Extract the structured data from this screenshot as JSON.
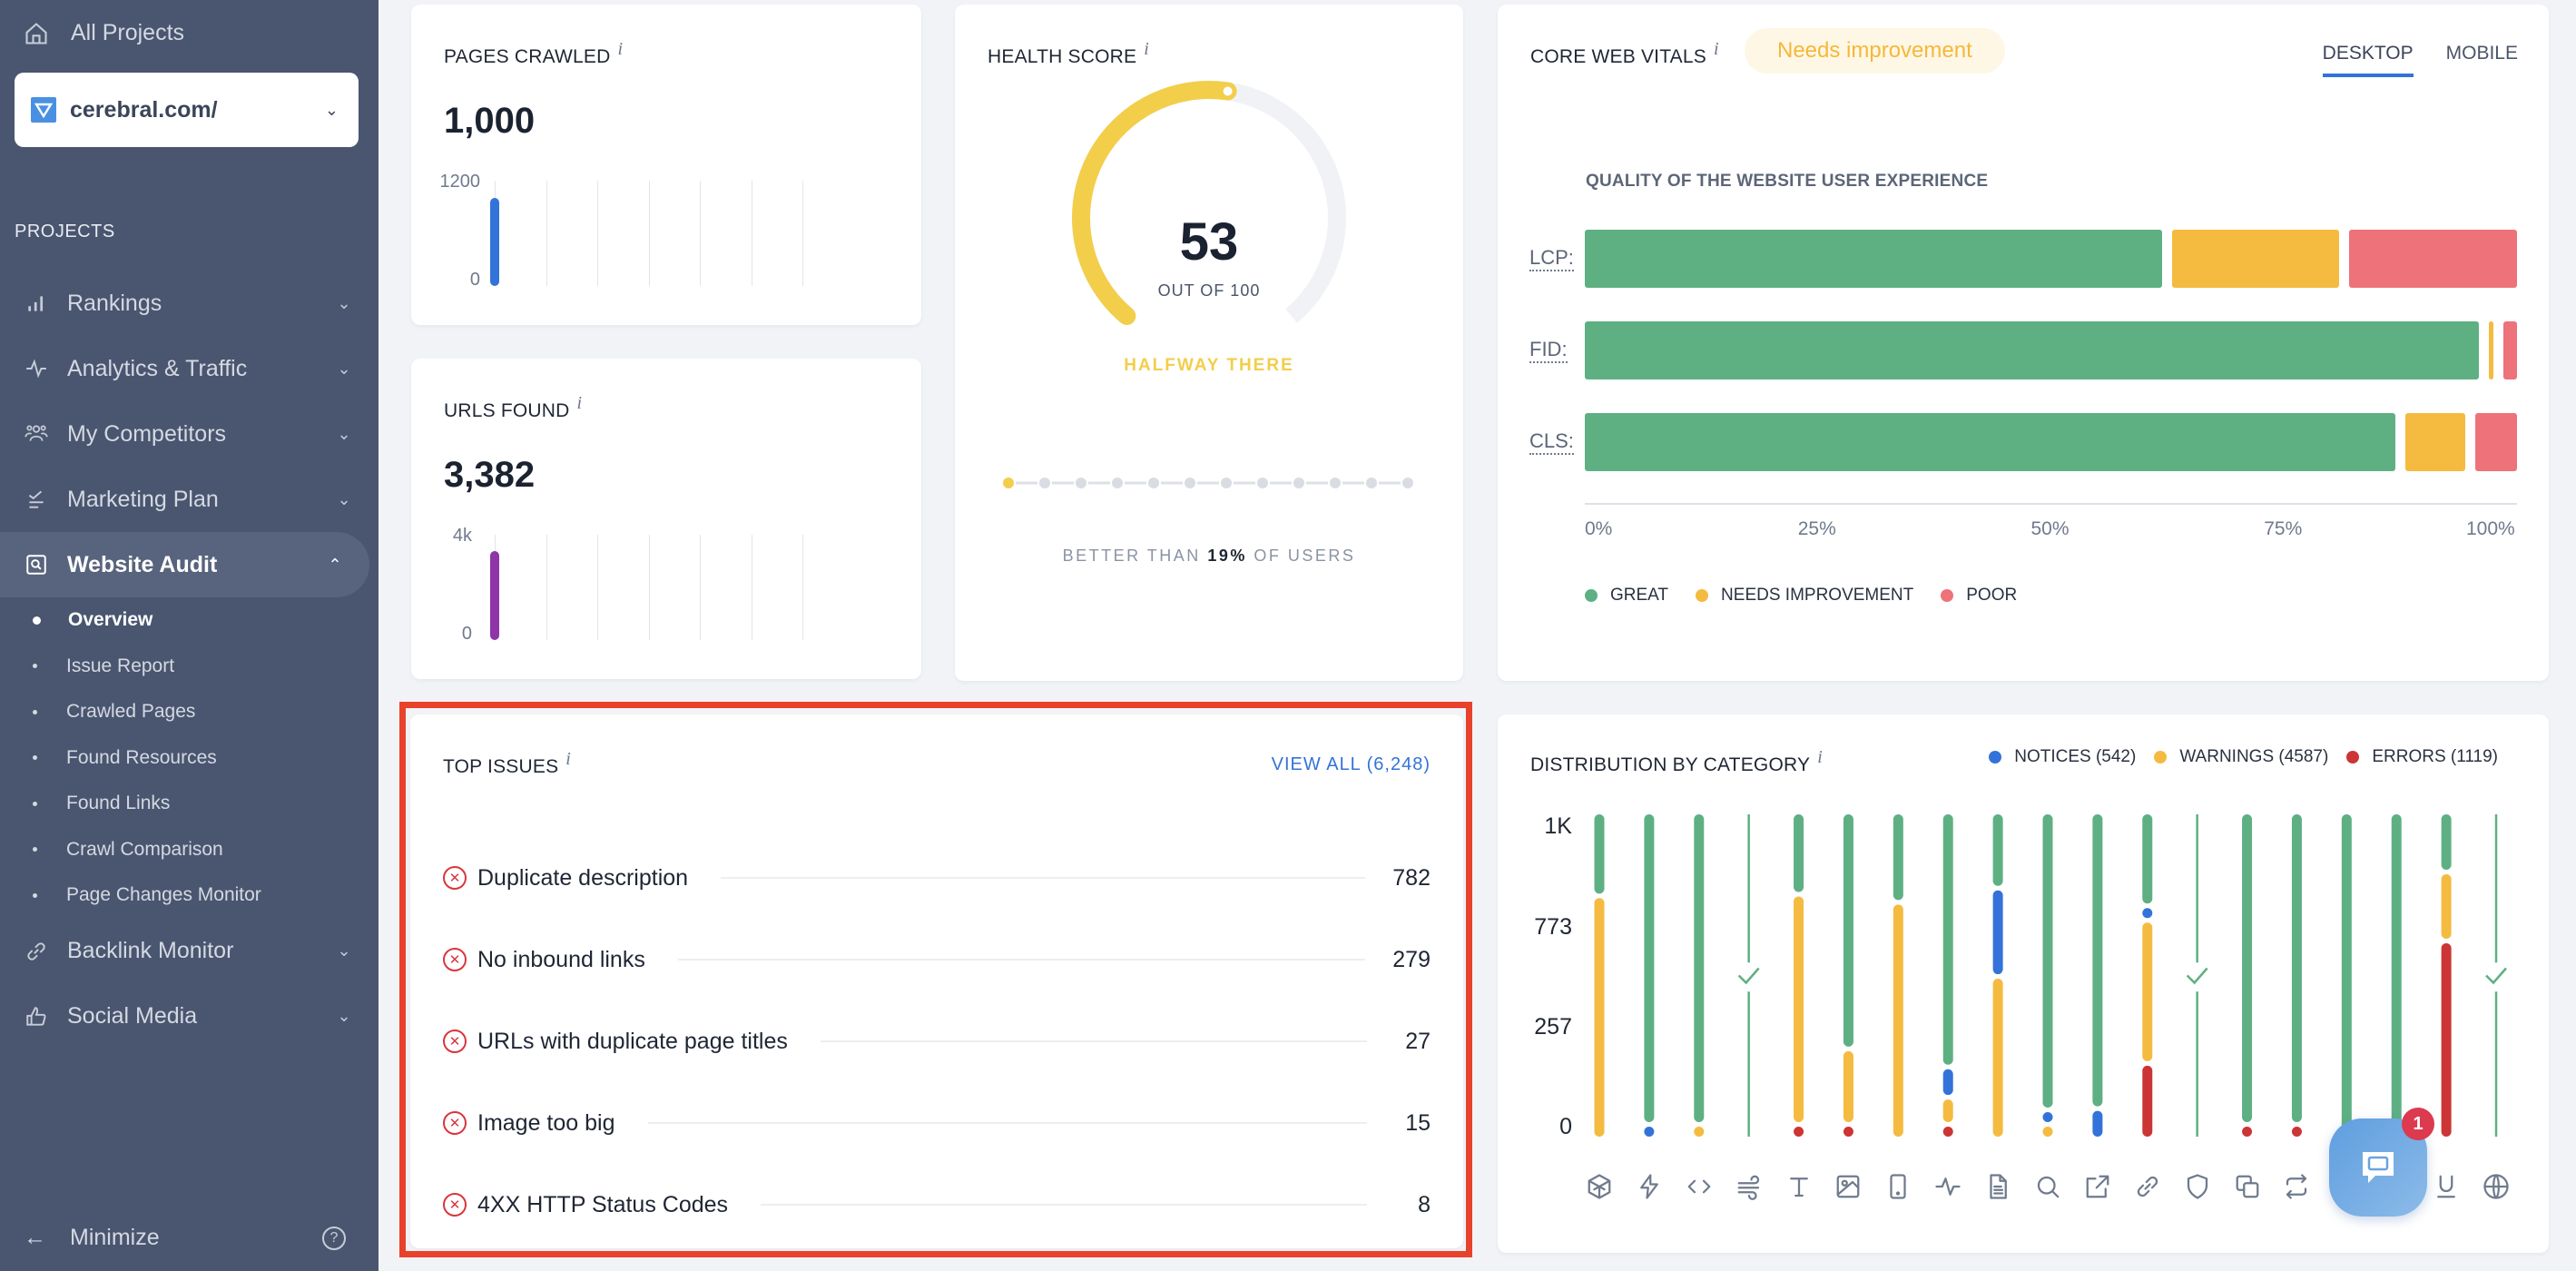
{
  "sidebar": {
    "all_projects": "All Projects",
    "project": {
      "name": "cerebral.com/",
      "icon": "project-logo-icon"
    },
    "section_label": "PROJECTS",
    "items": [
      {
        "label": "Rankings",
        "icon": "bar-chart-icon",
        "expanded": false
      },
      {
        "label": "Analytics & Traffic",
        "icon": "pulse-icon",
        "expanded": false
      },
      {
        "label": "My Competitors",
        "icon": "users-icon",
        "expanded": false
      },
      {
        "label": "Marketing Plan",
        "icon": "checklist-icon",
        "expanded": false
      },
      {
        "label": "Website Audit",
        "icon": "audit-search-icon",
        "expanded": true,
        "active": true
      },
      {
        "label": "Backlink Monitor",
        "icon": "link-icon",
        "expanded": false
      },
      {
        "label": "Social Media",
        "icon": "thumbs-up-icon",
        "expanded": false
      }
    ],
    "subitems": [
      {
        "label": "Overview",
        "active": true
      },
      {
        "label": "Issue Report"
      },
      {
        "label": "Crawled Pages"
      },
      {
        "label": "Found Resources"
      },
      {
        "label": "Found Links"
      },
      {
        "label": "Crawl Comparison"
      },
      {
        "label": "Page Changes Monitor"
      }
    ],
    "minimize": "Minimize",
    "help": "?"
  },
  "pages_crawled": {
    "title": "PAGES CRAWLED",
    "info": "i",
    "value": "1,000",
    "axis_max": "1200",
    "axis_min": "0",
    "max": 1200,
    "bars": [
      1000
    ],
    "slots": 7,
    "color": "#3373d9"
  },
  "urls_found": {
    "title": "URLS FOUND",
    "info": "i",
    "value": "3,382",
    "axis_max": "4k",
    "axis_min": "0",
    "max": 4000,
    "bars": [
      3382
    ],
    "slots": 7,
    "color": "#8e35a8"
  },
  "health_score": {
    "title": "HEALTH SCORE",
    "info": "i",
    "score": "53",
    "score_value": 53,
    "out_of": "OUT OF 100",
    "status": "HALFWAY THERE",
    "status_color": "#f2ce4b",
    "progress_steps": 12,
    "progress_active": 1,
    "better_prefix": "BETTER THAN",
    "better_value": "19%",
    "better_suffix": "OF USERS"
  },
  "core_web_vitals": {
    "title": "CORE WEB VITALS",
    "info": "i",
    "badge": "Needs improvement",
    "tabs": [
      {
        "label": "DESKTOP",
        "active": true
      },
      {
        "label": "MOBILE",
        "active": false
      }
    ],
    "subtitle": "QUALITY OF THE WEBSITE USER EXPERIENCE",
    "colors": {
      "great": "#5eb083",
      "needs": "#f4bb40",
      "poor": "#ed727a"
    },
    "legend": [
      "GREAT",
      "NEEDS IMPROVEMENT",
      "POOR"
    ],
    "ticks": [
      "0%",
      "25%",
      "50%",
      "75%",
      "100%"
    ]
  },
  "top_issues": {
    "title": "TOP ISSUES",
    "info": "i",
    "view_all": "VIEW ALL (6,248)",
    "items": [
      {
        "name": "Duplicate description",
        "count": "782"
      },
      {
        "name": "No inbound links",
        "count": "279"
      },
      {
        "name": "URLs with duplicate page titles",
        "count": "27"
      },
      {
        "name": "Image too big",
        "count": "15"
      },
      {
        "name": "4XX HTTP Status Codes",
        "count": "8"
      }
    ]
  },
  "distribution": {
    "title": "DISTRIBUTION BY CATEGORY",
    "info": "i",
    "legend": [
      {
        "label": "NOTICES (542)",
        "color": "#3373d9"
      },
      {
        "label": "WARNINGS (4587)",
        "color": "#f4bb40"
      },
      {
        "label": "ERRORS (1119)",
        "color": "#cc3535"
      }
    ]
  },
  "chart_data": [
    {
      "type": "bar",
      "title": "CORE WEB VITALS — QUALITY OF THE WEBSITE USER EXPERIENCE",
      "orientation": "horizontal-stacked",
      "categories": [
        "LCP:",
        "FID:",
        "CLS:"
      ],
      "series": [
        {
          "name": "GREAT",
          "values": [
            63,
            97,
            88
          ]
        },
        {
          "name": "NEEDS IMPROVEMENT",
          "values": [
            19,
            1.5,
            7.5
          ]
        },
        {
          "name": "POOR",
          "values": [
            18,
            1.5,
            4.5
          ]
        }
      ],
      "xlabel": "",
      "ylabel": "",
      "xlim": [
        0,
        100
      ],
      "ticks": [
        "0%",
        "25%",
        "50%",
        "75%",
        "100%"
      ],
      "legend": "bottom-left"
    },
    {
      "type": "bar",
      "title": "DISTRIBUTION BY CATEGORY",
      "orientation": "vertical-stacked",
      "y_tick_labels": [
        "0",
        "257",
        "773",
        "1K"
      ],
      "categories": [
        "html-structure",
        "performance",
        "code",
        "flow",
        "text",
        "images",
        "mobile",
        "status-pulse",
        "content-page",
        "search",
        "external-links",
        "internal-links",
        "security",
        "duplicates",
        "redirects",
        "category-16",
        "category-17",
        "underline-formatting",
        "international"
      ],
      "category_icons": [
        "cube-icon",
        "lightning-icon",
        "code-icon",
        "wind-icon",
        "text-icon",
        "image-icon",
        "mobile-icon",
        "pulse-icon",
        "document-icon",
        "search-icon",
        "external-link-icon",
        "link-icon",
        "shield-icon",
        "copy-icon",
        "repeat-icon",
        "",
        "",
        "underline-icon",
        "globe-icon"
      ],
      "note": "stacked share of bar height (bottom to top): errors, warnings, notices; remainder passed (green). 'ok' marks categories with no issues (checkmark).",
      "series": [
        {
          "name": "ERRORS",
          "color": "#cc3535",
          "values": [
            0,
            0,
            0,
            0,
            0.02,
            0.02,
            0,
            0.02,
            0,
            0,
            0,
            0.22,
            0,
            0.02,
            0.02,
            0,
            0,
            0.6,
            0
          ]
        },
        {
          "name": "WARNINGS",
          "color": "#f4bb40",
          "values": [
            0.74,
            0,
            0.02,
            0,
            0.7,
            0.22,
            0.72,
            0.07,
            0.49,
            0.02,
            0,
            0.43,
            0,
            0,
            0,
            0,
            0,
            0.2,
            0
          ]
        },
        {
          "name": "NOTICES",
          "color": "#3373d9",
          "values": [
            0,
            0.02,
            0,
            0,
            0,
            0,
            0,
            0.08,
            0.26,
            0.02,
            0.08,
            0.02,
            0,
            0,
            0,
            0,
            0,
            0,
            0
          ]
        },
        {
          "name": "PASSED",
          "color": "#5eb083"
        }
      ],
      "ok": [
        false,
        false,
        false,
        true,
        false,
        false,
        false,
        false,
        false,
        false,
        false,
        false,
        true,
        false,
        false,
        false,
        false,
        false,
        true
      ],
      "legend": "top-right"
    }
  ],
  "chat": {
    "badge": "1"
  }
}
